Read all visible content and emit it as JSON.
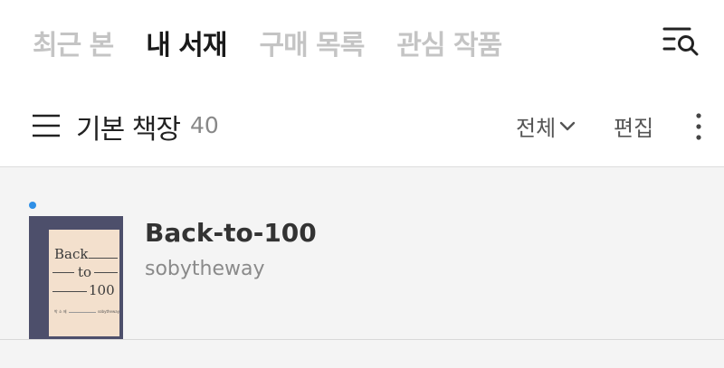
{
  "tabs": [
    {
      "label": "최근 본",
      "active": false
    },
    {
      "label": "내 서재",
      "active": true
    },
    {
      "label": "구매 목록",
      "active": false
    },
    {
      "label": "관심 작품",
      "active": false
    }
  ],
  "shelf": {
    "title": "기본 책장",
    "count": "40",
    "filter_label": "전체",
    "edit_label": "편집"
  },
  "books": [
    {
      "title": "Back-to-100",
      "author": "sobytheway",
      "is_new": true,
      "cover": {
        "line1": "Back",
        "line2": "to",
        "line3": "100",
        "small_left": "박 소 제",
        "small_right": "sobytheway",
        "bg_color": "#4d4f6b",
        "paper_color": "#f3e0cd"
      }
    }
  ],
  "colors": {
    "tab_active": "#1a1a1a",
    "tab_inactive": "#c4c4c4",
    "new_dot": "#2f8fe6",
    "list_bg": "#f4f4f4"
  },
  "icons": {
    "search_menu": "search-list-icon",
    "hamburger": "hamburger-menu-icon",
    "filter_chevron": "chevron-down-icon",
    "more": "more-vertical-icon"
  }
}
